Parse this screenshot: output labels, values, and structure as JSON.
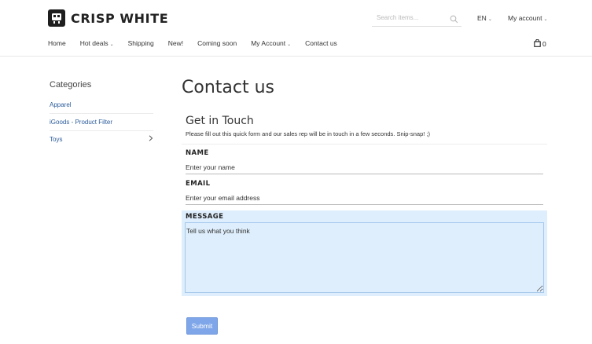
{
  "brand": {
    "name": "CRISP WHITE",
    "logo_icon": "robot-face-icon"
  },
  "header": {
    "search_placeholder": "Search items...",
    "language": "EN",
    "account_label": "My account"
  },
  "nav": {
    "items": [
      {
        "label": "Home",
        "has_dropdown": false
      },
      {
        "label": "Hot deals",
        "has_dropdown": true
      },
      {
        "label": "Shipping",
        "has_dropdown": false
      },
      {
        "label": "New!",
        "has_dropdown": false
      },
      {
        "label": "Coming soon",
        "has_dropdown": false
      },
      {
        "label": "My Account",
        "has_dropdown": true
      },
      {
        "label": "Contact us",
        "has_dropdown": false
      }
    ],
    "cart_count": "0"
  },
  "sidebar": {
    "title": "Categories",
    "items": [
      {
        "label": "Apparel"
      },
      {
        "label": "iGoods - Product Filter"
      },
      {
        "label": "Toys"
      }
    ]
  },
  "page": {
    "title": "Contact us"
  },
  "form": {
    "heading": "Get in Touch",
    "intro": "Please fill out this quick form and our sales rep will be in touch in a few seconds. Snip-snap! ;)",
    "name_label": "NAME",
    "name_placeholder": "Enter your name",
    "email_label": "EMAIL",
    "email_placeholder": "Enter your email address",
    "message_label": "MESSAGE",
    "message_placeholder": "Tell us what you think",
    "submit_label": "Submit"
  },
  "colors": {
    "link": "#2c5c9b",
    "focus_bg": "#deeefc",
    "button": "#7fa6e8"
  }
}
